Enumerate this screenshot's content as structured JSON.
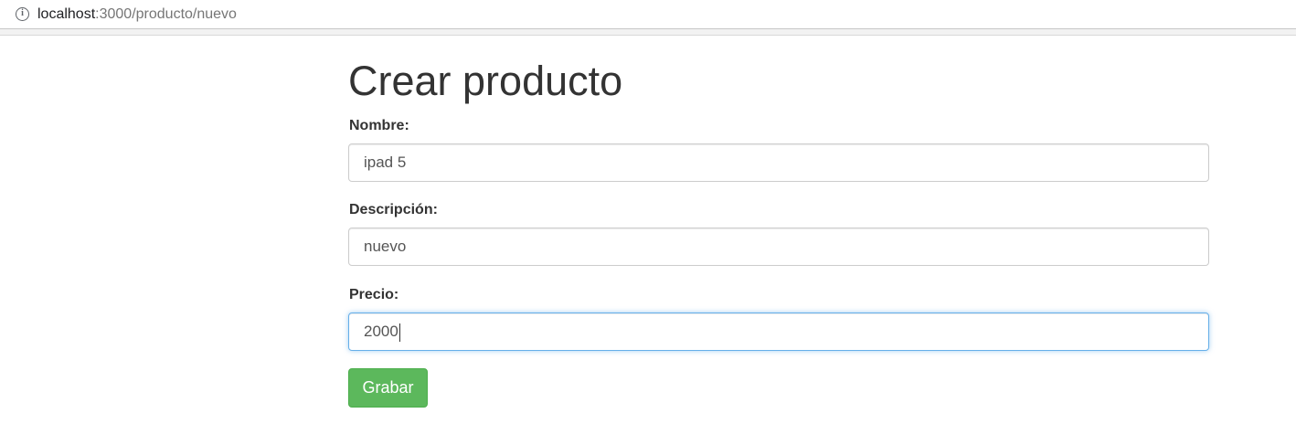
{
  "browser": {
    "url_host": "localhost",
    "url_path": ":3000/producto/nuevo",
    "info_icon": "info-circle-icon"
  },
  "page": {
    "title": "Crear producto"
  },
  "form": {
    "nombre": {
      "label": "Nombre:",
      "value": "ipad 5"
    },
    "descripcion": {
      "label": "Descripción:",
      "value": "nuevo"
    },
    "precio": {
      "label": "Precio:",
      "value": "2000"
    },
    "submit_label": "Grabar"
  },
  "colors": {
    "button_bg": "#5cb85c",
    "focus_border": "#66afe9",
    "text": "#333333"
  }
}
